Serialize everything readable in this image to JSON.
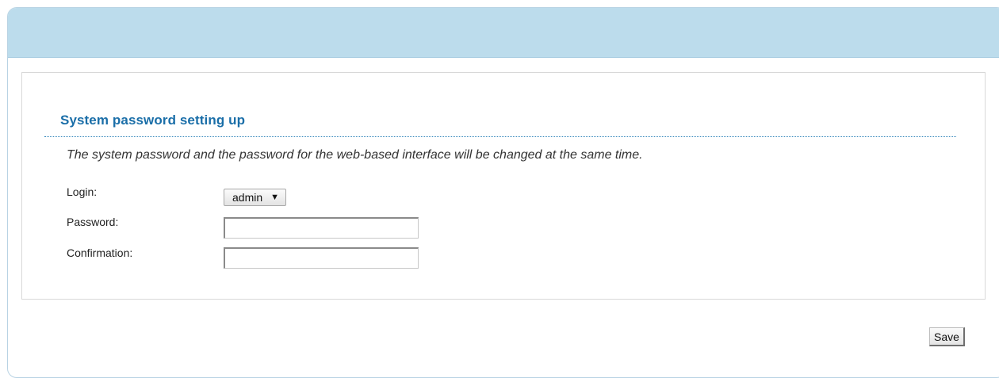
{
  "section": {
    "title": "System password setting up",
    "description": "The system password and the password for the web-based interface will be changed at the same time."
  },
  "form": {
    "login_label": "Login:",
    "login_value": "admin",
    "login_arrow": "▼",
    "password_label": "Password:",
    "password_value": "",
    "confirmation_label": "Confirmation:",
    "confirmation_value": ""
  },
  "actions": {
    "save_label": "Save"
  },
  "colors": {
    "header_bg": "#bcdcec",
    "title_color": "#1a6ea8"
  }
}
